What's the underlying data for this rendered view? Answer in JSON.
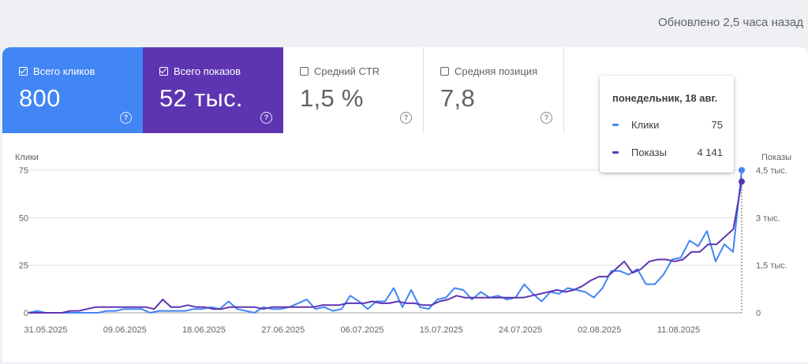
{
  "header": {
    "updated_text": "Обновлено 2,5 часа назад"
  },
  "cards": [
    {
      "label": "Всего кликов",
      "value": "800",
      "checked": true
    },
    {
      "label": "Всего показов",
      "value": "52 тыс.",
      "checked": true
    },
    {
      "label": "Средний CTR",
      "value": "1,5 %",
      "checked": false
    },
    {
      "label": "Средняя позиция",
      "value": "7,8",
      "checked": false
    }
  ],
  "tooltip": {
    "date": "понедельник, 18 авг.",
    "rows": [
      {
        "label": "Клики",
        "value": "75"
      },
      {
        "label": "Показы",
        "value": "4 141"
      }
    ]
  },
  "colors": {
    "clicks": "#4285f4",
    "impressions": "#5e35b1",
    "grid": "#e0e0e0",
    "text": "#5f6368"
  },
  "chart_data": {
    "type": "line",
    "xlabels": [
      "31.05.2025",
      "09.06.2025",
      "18.06.2025",
      "27.06.2025",
      "06.07.2025",
      "15.07.2025",
      "24.07.2025",
      "02.08.2025",
      "11.08.2025"
    ],
    "y_left": {
      "label": "Клики",
      "ticks": [
        "0",
        "25",
        "50",
        "75"
      ],
      "range": [
        0,
        75
      ]
    },
    "y_right": {
      "label": "Показы",
      "ticks": [
        "0",
        "1,5 тыс.",
        "3 тыс.",
        "4,5 тыс."
      ],
      "range": [
        0,
        4500
      ]
    },
    "highlight_index": 79,
    "series": [
      {
        "name": "Клики",
        "axis": "left",
        "values": [
          0,
          1,
          0,
          0,
          0,
          0,
          0,
          0,
          0,
          1,
          1,
          2,
          2,
          2,
          0,
          1,
          1,
          1,
          1,
          2,
          2,
          3,
          2,
          6,
          2,
          1,
          0,
          3,
          2,
          2,
          3,
          5,
          7,
          2,
          3,
          1,
          2,
          9,
          6,
          2,
          6,
          6,
          13,
          3,
          12,
          3,
          2,
          7,
          8,
          13,
          12,
          7,
          11,
          8,
          9,
          7,
          8,
          15,
          10,
          6,
          11,
          10,
          13,
          12,
          11,
          8,
          13,
          22,
          22,
          20,
          23,
          15,
          15,
          20,
          28,
          29,
          38,
          35,
          43,
          27,
          36,
          32,
          75
        ]
      },
      {
        "name": "Показы",
        "axis": "left",
        "values": [
          0,
          0,
          0,
          0,
          0,
          1,
          1,
          2,
          3,
          3,
          3,
          3,
          3,
          3,
          3,
          2,
          7,
          3,
          3,
          4,
          3,
          3,
          2,
          2,
          3,
          3,
          3,
          3,
          2,
          3,
          3,
          3,
          3,
          3,
          3,
          4,
          4,
          4,
          5,
          5,
          5,
          6,
          5,
          5,
          6,
          5,
          5,
          4,
          4,
          6,
          7,
          9,
          8,
          8,
          8,
          8,
          8,
          8,
          8,
          8,
          9,
          10,
          11,
          12,
          11,
          12,
          14,
          17,
          19,
          19,
          23,
          27,
          21,
          23,
          27,
          28,
          28,
          27,
          28,
          32,
          32,
          36,
          36,
          40,
          44,
          69
        ]
      }
    ]
  }
}
